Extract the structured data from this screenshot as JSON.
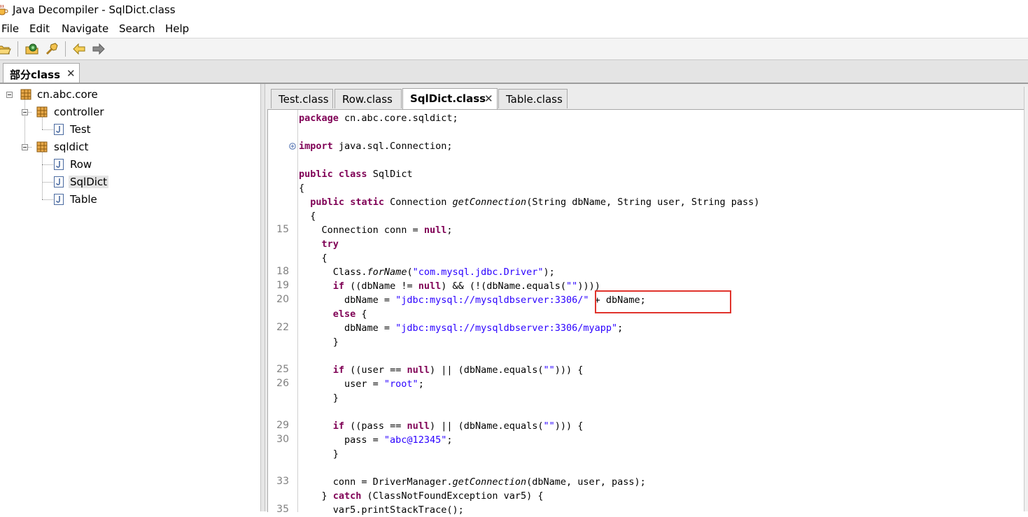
{
  "window": {
    "title": "Java Decompiler - SqlDict.class"
  },
  "menu": [
    "File",
    "Edit",
    "Navigate",
    "Search",
    "Help"
  ],
  "toolbar": {
    "icons": [
      "open-folder-icon",
      "open-type-icon",
      "search-icon",
      "back-arrow-icon",
      "forward-arrow-icon"
    ]
  },
  "file_tab": {
    "label": "部分class",
    "close": "✕"
  },
  "tree": {
    "root": "cn.abc.core",
    "packages": [
      {
        "name": "controller",
        "classes": [
          "Test"
        ]
      },
      {
        "name": "sqldict",
        "classes": [
          "Row",
          "SqlDict",
          "Table"
        ]
      }
    ],
    "selected": "SqlDict"
  },
  "class_tabs": [
    {
      "label": "Test.class",
      "active": false
    },
    {
      "label": "Row.class",
      "active": false
    },
    {
      "label": "SqlDict.class",
      "active": true,
      "close": "✕"
    },
    {
      "label": "Table.class",
      "active": false
    }
  ],
  "code": [
    {
      "ln": "",
      "text": "package cn.abc.core.sqldict;"
    },
    {
      "ln": "",
      "text": ""
    },
    {
      "ln": "",
      "text": "import java.sql.Connection;",
      "fold": true
    },
    {
      "ln": "",
      "text": ""
    },
    {
      "ln": "",
      "text": "public class SqlDict"
    },
    {
      "ln": "",
      "text": "{"
    },
    {
      "ln": "",
      "text": "  public static Connection getConnection(String dbName, String user, String pass)"
    },
    {
      "ln": "",
      "text": "  {"
    },
    {
      "ln": "15",
      "text": "    Connection conn = null;"
    },
    {
      "ln": "",
      "text": "    try"
    },
    {
      "ln": "",
      "text": "    {"
    },
    {
      "ln": "18",
      "text": "      Class.forName(\"com.mysql.jdbc.Driver\");"
    },
    {
      "ln": "19",
      "text": "      if ((dbName != null) && (!(dbName.equals(\"\"))))"
    },
    {
      "ln": "20",
      "text": "        dbName = \"jdbc:mysql://mysqldbserver:3306/\" + dbName;"
    },
    {
      "ln": "",
      "text": "      else {"
    },
    {
      "ln": "22",
      "text": "        dbName = \"jdbc:mysql://mysqldbserver:3306/myapp\";"
    },
    {
      "ln": "",
      "text": "      }"
    },
    {
      "ln": "",
      "text": ""
    },
    {
      "ln": "25",
      "text": "      if ((user == null) || (dbName.equals(\"\"))) {"
    },
    {
      "ln": "26",
      "text": "        user = \"root\";"
    },
    {
      "ln": "",
      "text": "      }"
    },
    {
      "ln": "",
      "text": ""
    },
    {
      "ln": "29",
      "text": "      if ((pass == null) || (dbName.equals(\"\"))) {"
    },
    {
      "ln": "30",
      "text": "        pass = \"abc@12345\";"
    },
    {
      "ln": "",
      "text": "      }"
    },
    {
      "ln": "",
      "text": ""
    },
    {
      "ln": "33",
      "text": "      conn = DriverManager.getConnection(dbName, user, pass);"
    },
    {
      "ln": "",
      "text": "    } catch (ClassNotFoundException var5) {"
    },
    {
      "ln": "35",
      "text": "      var5.printStackTrace();"
    }
  ],
  "colors": {
    "keyword": "#7f0055",
    "string": "#2a00ff",
    "highlight": "#e0332c"
  }
}
